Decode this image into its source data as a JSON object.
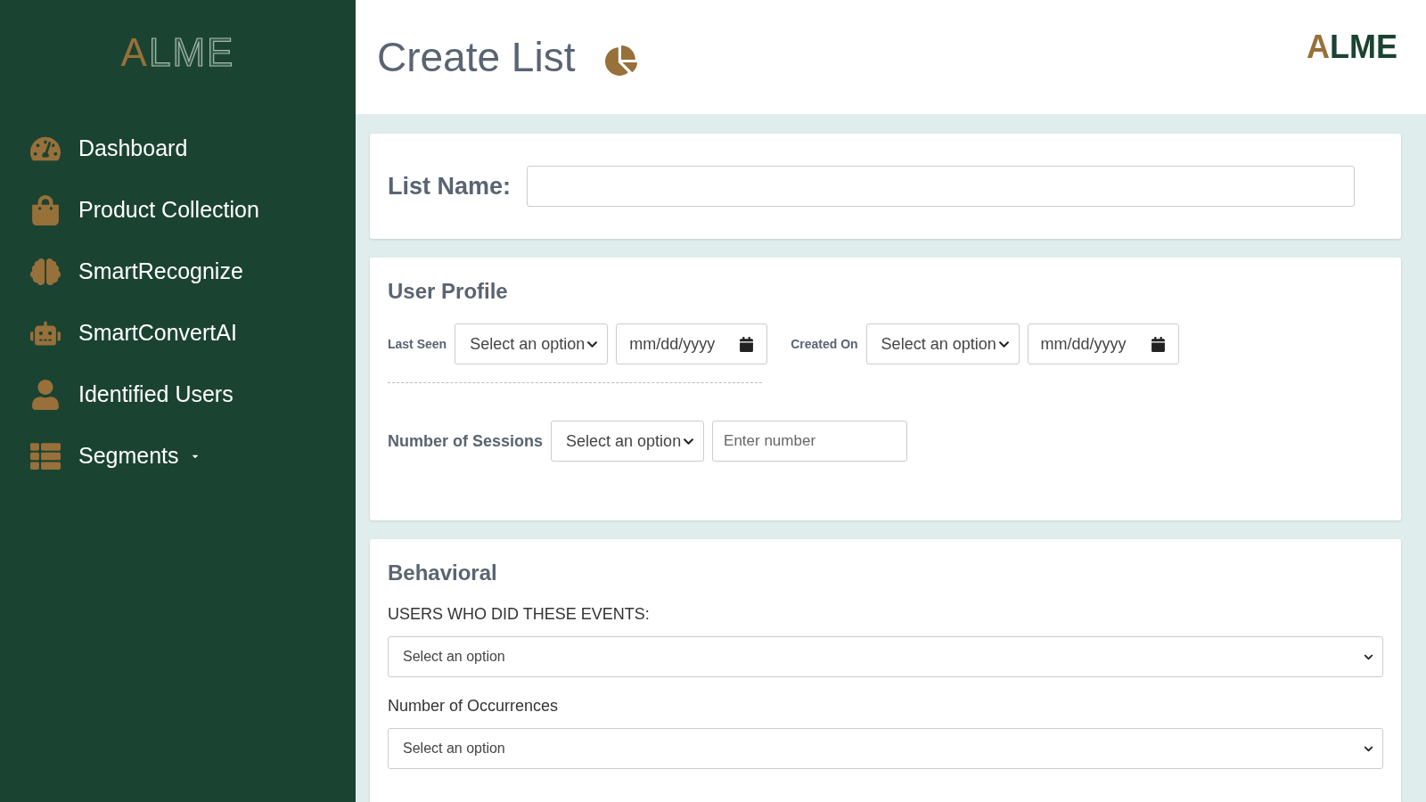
{
  "sidebar": {
    "logo": "ALME",
    "items": [
      {
        "label": "Dashboard"
      },
      {
        "label": "Product Collection"
      },
      {
        "label": "SmartRecognize"
      },
      {
        "label": "SmartConvertAI"
      },
      {
        "label": "Identified Users"
      },
      {
        "label": "Segments",
        "expanded": false
      }
    ]
  },
  "header": {
    "title": "Create List",
    "logo": "ALME"
  },
  "list_name": {
    "label": "List Name:"
  },
  "user_profile": {
    "title": "User Profile",
    "last_seen": {
      "label": "Last Seen",
      "select": "Select an option",
      "date_placeholder": "mm/dd/yyyy"
    },
    "created_on": {
      "label": "Created On",
      "select": "Select an option",
      "date_placeholder": "mm/dd/yyyy"
    },
    "sessions": {
      "label": "Number of Sessions",
      "select": "Select an option",
      "placeholder": "Enter number"
    }
  },
  "behavioral": {
    "title": "Behavioral",
    "events": {
      "label": "USERS WHO DID THESE EVENTS:",
      "select": "Select an option"
    },
    "occurrences": {
      "label": "Number of Occurrences",
      "select": "Select an option"
    }
  }
}
